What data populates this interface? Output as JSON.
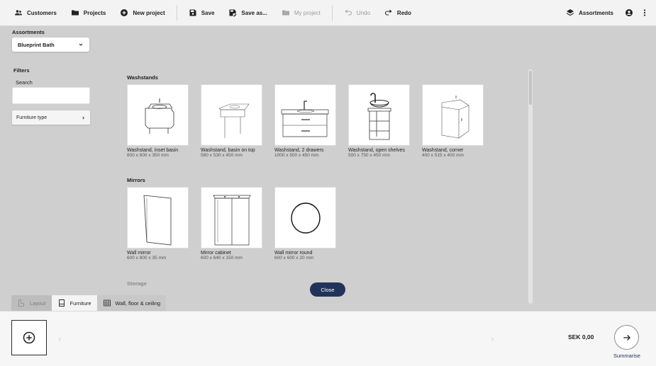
{
  "toolbar": {
    "customers": "Customers",
    "projects": "Projects",
    "new_project": "New project",
    "save": "Save",
    "save_as": "Save as...",
    "my_project": "My project",
    "undo": "Undo",
    "redo": "Redo",
    "assortments": "Assortments"
  },
  "left": {
    "assortments_label": "Assortments",
    "assortment_value": "Blueprint Bath",
    "filters_label": "Filters",
    "search_label": "Search",
    "search_value": "",
    "furniture_type": "Furniture type"
  },
  "catalog": {
    "washstands_title": "Washstands",
    "mirrors_title": "Mirrors",
    "storage_title": "Storage",
    "washstands": [
      {
        "name": "Washstand, inset basin",
        "dims": "600 x 600 x 350 mm"
      },
      {
        "name": "Washstand, basin on top",
        "dims": "580 x 530 x 450 mm"
      },
      {
        "name": "Washstand, 2 drawers",
        "dims": "1000 x 500 x 450 mm"
      },
      {
        "name": "Washstand, open shelves",
        "dims": "500 x 750 x 450 mm"
      },
      {
        "name": "Washstand, corner",
        "dims": "400 x 515 x 400 mm"
      }
    ],
    "mirrors": [
      {
        "name": "Wall mirror",
        "dims": "600 x 800 x 35 mm"
      },
      {
        "name": "Mirror cabinet",
        "dims": "600 x 640 x 150 mm"
      },
      {
        "name": "Wall mirror round",
        "dims": "600 x 600 x 20 mm"
      }
    ],
    "close": "Close"
  },
  "tabs": {
    "layout": "Layout",
    "furniture": "Furniture",
    "wall": "Wall, floor & ceiling"
  },
  "bottom": {
    "price": "SEK 0,00",
    "summarise": "Summarise"
  },
  "colors": {
    "accent": "#21325b"
  }
}
